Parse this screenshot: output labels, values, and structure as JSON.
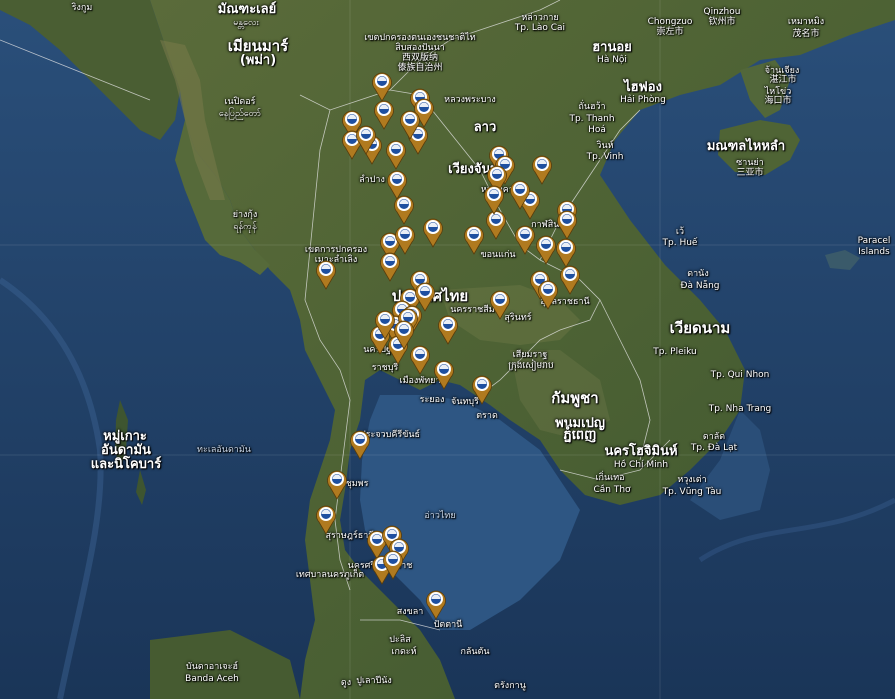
{
  "map": {
    "labels": {
      "l1": "ริงกูม",
      "l2": "มัณฑะเลย์",
      "l3": "မန္တလေး",
      "l4": "เมียนมาร์",
      "l5": "(พม่า)",
      "l6": "เนปิดอร์",
      "l7": "နေပြည်တော်",
      "l8": "ย่างกุ้ง",
      "l9": "ရန်ကုန်",
      "l10": "เขตปกครองตนเองชนชาติไท",
      "l11": "สิบสองปันนา",
      "l12": "西双版纳",
      "l13": "傣族自治州",
      "l14": "หลวงพระบาง",
      "l15": "ลาว",
      "l16": "ลำปาง",
      "l17": "เวียงจันทน์",
      "l18": "หนองคาย",
      "l19": "ขอนแก่น",
      "l20": "กาฬสินธุ์",
      "l21": "ประเทศไทย",
      "l22": "นครราชสีมา",
      "l23": "สุรินทร์",
      "l24": "อุบลราชธานี",
      "l25": "เขตการปกครอง",
      "l26": "เมาะลำเลิง",
      "l27": "นครปฐม",
      "l28": "ราชบุรี",
      "l29": "เมืองพัทยา",
      "l30": "ระยอง",
      "l31": "จันทบุรี",
      "l32": "ตราด",
      "l33": "เสียมราฐ",
      "l34": "ក្រុងសៀមរាប",
      "l35": "กัมพูชา",
      "l36": "พนมเปญ",
      "l37": "ភ្នំពេញ",
      "l38": "นครโฮจิมินห์",
      "l39": "Hồ Chí Minh",
      "l40": "เกิ่นเทอ",
      "l41": "Cần Thơ",
      "l42": "หวุงเต่า",
      "l43": "Tp. Vũng Tàu",
      "l44": "ประจวบคีรีขันธ์",
      "l45": "ชุมพร",
      "l46": "สุราษฎร์ธานี",
      "l47": "นครศรีธรรมราช",
      "l48": "เทศบาลนครภูเก็ต",
      "l49": "สงขลา",
      "l50": "ปัตตานี",
      "l51": "ปะลิส",
      "l52": "เกดะห์",
      "l53": "กลันตัน",
      "l54": "ปูเลาปีนัง",
      "l55": "ตรังกานู",
      "l56": "บันดาอาเจะฮ์",
      "l57": "Banda Aceh",
      "l58": "หมู่เกาะ",
      "l59": "อันดามัน",
      "l60": "และนิโคบาร์",
      "l61": "ทะเลอันดามัน",
      "l62": "อ่าวไทย",
      "l63": "หล่าวกาย",
      "l64": "Tp. Lào Cai",
      "l65": "ฮานอย",
      "l66": "Hà Nội",
      "l67": "ไฮฟอง",
      "l68": "Hải Phòng",
      "l69": "ถั่นฮว้า",
      "l70": "Tp. Thanh",
      "l71": "Hoá",
      "l72": "วินห์",
      "l73": "Tp. Vinh",
      "l74": "เว้",
      "l75": "Tp. Huế",
      "l76": "ดานัง",
      "l77": "Đà Nẵng",
      "l78": "เวียดนาม",
      "l79": "Tp. Pleiku",
      "l80": "Tp. Qui Nhon",
      "l81": "Tp. Nha Trang",
      "l82": "ดาลัด",
      "l83": "Tp. Đà Lạt",
      "l84": "Chongzuo",
      "l85": "崇左市",
      "l86": "Qinzhou",
      "l87": "钦州市",
      "l88": "เหมาหมิง",
      "l89": "茂名市",
      "l90": "จ้านเจียง",
      "l91": "湛江市",
      "l92": "ไหโข่ว",
      "l93": "海口市",
      "l94": "มณฑลไหหลำ",
      "l95": "ซานย่า",
      "l96": "三亚市",
      "l97": "Paracel",
      "l98": "Islands",
      "l99": "ดูง"
    },
    "marker_color": "#b07a1f",
    "marker_count": 60
  }
}
